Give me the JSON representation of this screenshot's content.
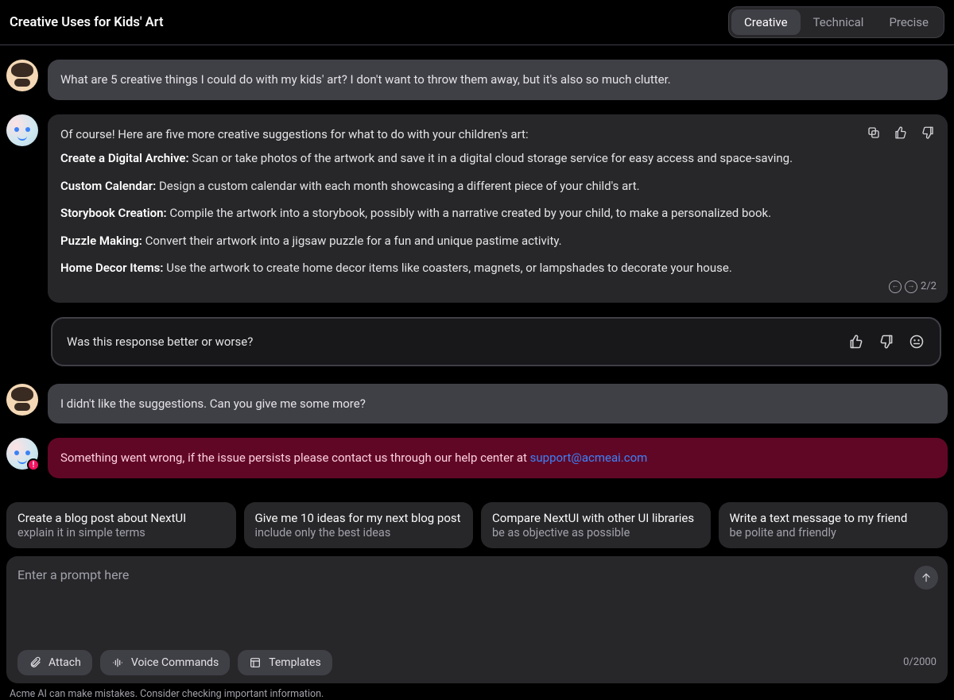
{
  "header": {
    "title": "Creative Uses for Kids' Art",
    "tabs": [
      "Creative",
      "Technical",
      "Precise"
    ],
    "active_tab": 0
  },
  "messages": {
    "user1": "What are 5 creative things I could do with my kids' art? I don't want to throw them away, but it's also so much clutter.",
    "assistant": {
      "intro": "Of course! Here are five more creative suggestions for what to do with your children's art:",
      "items": [
        {
          "title": "Create a Digital Archive:",
          "body": "Scan or take photos of the artwork and save it in a digital cloud storage service for easy access and space-saving."
        },
        {
          "title": "Custom Calendar:",
          "body": "Design a custom calendar with each month showcasing a different piece of your child's art."
        },
        {
          "title": "Storybook Creation:",
          "body": "Compile the artwork into a storybook, possibly with a narrative created by your child, to make a personalized book."
        },
        {
          "title": "Puzzle Making:",
          "body": "Convert their artwork into a jigsaw puzzle for a fun and unique pastime activity."
        },
        {
          "title": "Home Decor Items:",
          "body": "Use the artwork to create home decor items like coasters, magnets, or lampshades to decorate your house."
        }
      ],
      "pager": "2/2"
    },
    "feedback_prompt": "Was this response better or worse?",
    "user2": "I didn't like the suggestions. Can you give me some more?",
    "error": {
      "text": "Something went wrong, if the issue persists please contact us through our help center at ",
      "link": "support@acmeai.com"
    }
  },
  "suggestions": [
    {
      "title": "Create a blog post about NextUI",
      "sub": "explain it in simple terms"
    },
    {
      "title": "Give me 10 ideas for my next blog post",
      "sub": "include only the best ideas"
    },
    {
      "title": "Compare NextUI with other UI libraries",
      "sub": "be as objective as possible"
    },
    {
      "title": "Write a text message to my friend",
      "sub": "be polite and friendly"
    }
  ],
  "composer": {
    "placeholder": "Enter a prompt here",
    "attach": "Attach",
    "voice": "Voice Commands",
    "templates": "Templates",
    "counter": "0/2000"
  },
  "disclaimer": "Acme AI can make mistakes. Consider checking important information."
}
